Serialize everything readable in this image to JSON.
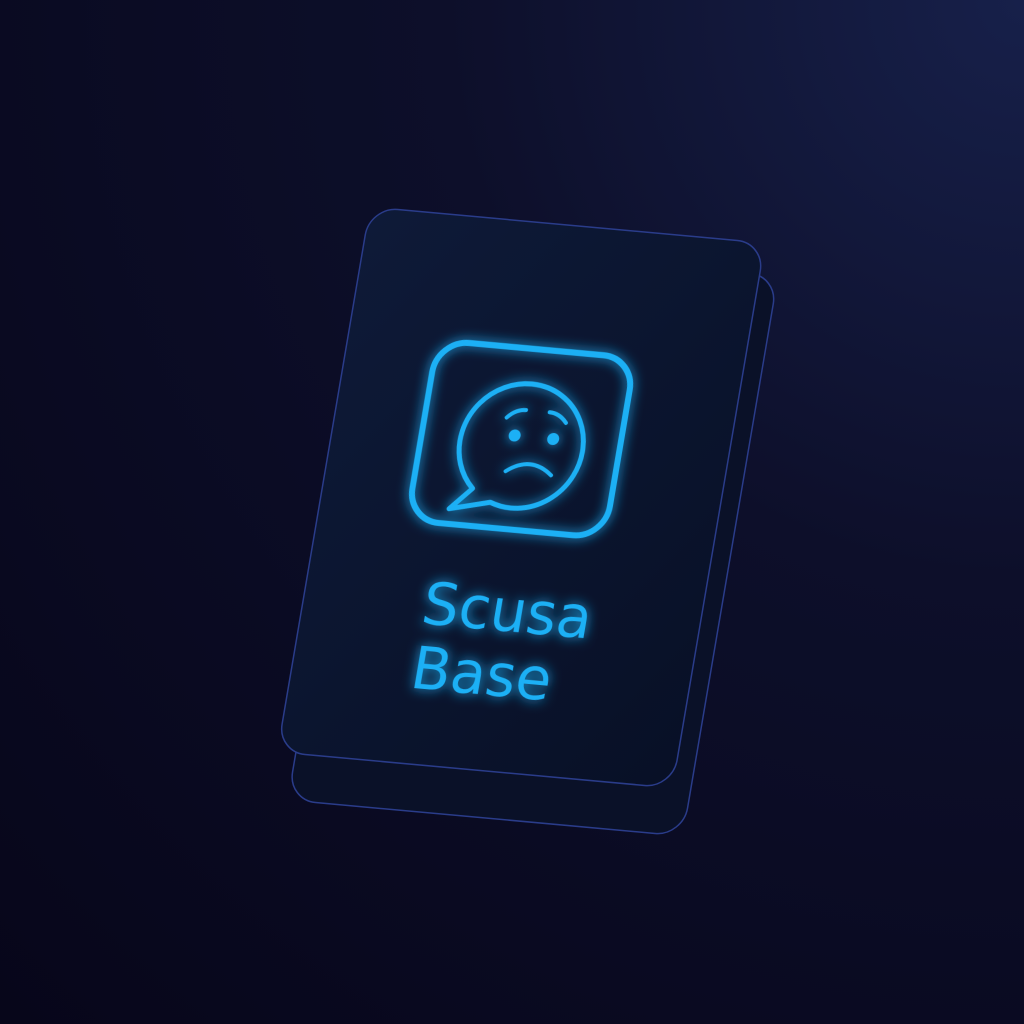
{
  "card": {
    "title_line1": "Scusa",
    "title_line2": "Base",
    "icon": "worried-face-speech-bubble-icon",
    "accent_color": "#1fb0f5",
    "card_color": "#0b1530",
    "background_color": "#0d0f2a"
  }
}
